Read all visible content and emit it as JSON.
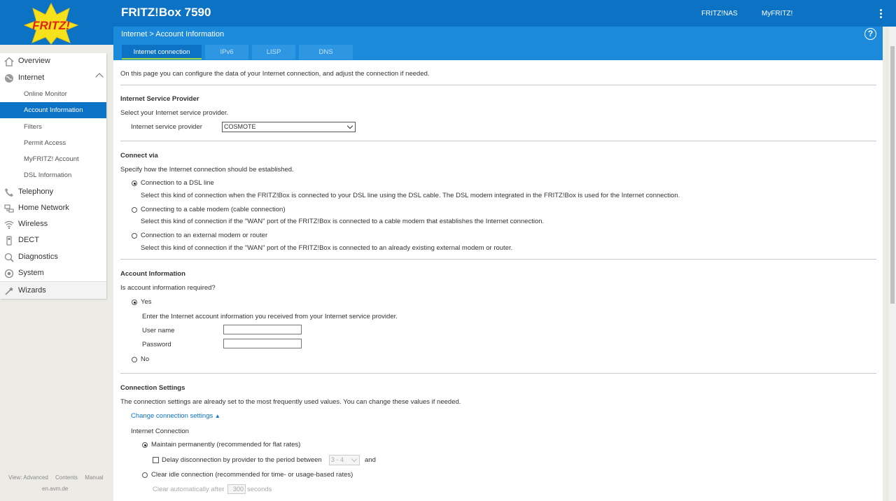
{
  "header": {
    "product": "FRITZ!Box 7590",
    "links": [
      "FRITZ!NAS",
      "MyFRITZ!"
    ],
    "brand_color": "#0c72c4"
  },
  "logo": {
    "text": "FRITZ!"
  },
  "subheader": {
    "breadcrumb": [
      "Internet",
      "Account Information"
    ],
    "separator": ">",
    "help": "?",
    "tabs": [
      {
        "label": "Internet connection",
        "active": true
      },
      {
        "label": "IPv6",
        "active": false
      },
      {
        "label": "LISP",
        "active": false
      },
      {
        "label": "DNS Server",
        "active": false
      }
    ]
  },
  "sidebar": {
    "items": [
      {
        "label": "Overview",
        "icon": "home-icon"
      },
      {
        "label": "Internet",
        "icon": "globe-icon",
        "expanded": true
      },
      {
        "label": "Telephony",
        "icon": "phone-icon"
      },
      {
        "label": "Home Network",
        "icon": "network-icon"
      },
      {
        "label": "Wireless",
        "icon": "wifi-icon"
      },
      {
        "label": "DECT",
        "icon": "dect-phone-icon"
      },
      {
        "label": "Diagnostics",
        "icon": "diagnostics-icon"
      },
      {
        "label": "System",
        "icon": "system-gear-icon"
      },
      {
        "label": "Wizards",
        "icon": "wand-icon"
      }
    ],
    "internet_sub": [
      {
        "label": "Online Monitor",
        "active": false
      },
      {
        "label": "Account Information",
        "active": true
      },
      {
        "label": "Filters",
        "active": false
      },
      {
        "label": "Permit Access",
        "active": false
      },
      {
        "label": "MyFRITZ! Account",
        "active": false
      },
      {
        "label": "DSL Information",
        "active": false
      }
    ],
    "footer": {
      "view": "View: Advanced",
      "contents": "Contents",
      "manual": "Manual",
      "site": "en.avm.de"
    }
  },
  "page": {
    "intro": "On this page you can configure the data of your Internet connection, and adjust the connection if needed.",
    "isp": {
      "title": "Internet Service Provider",
      "desc": "Select your Internet service provider.",
      "label": "Internet service provider",
      "value": "COSMOTE"
    },
    "connect": {
      "title": "Connect via",
      "desc": "Specify how the Internet connection should be established.",
      "options": [
        {
          "label": "Connection to a DSL line",
          "desc": "Select this kind of connection when the FRITZ!Box is connected to your DSL line using the DSL cable. The DSL modem integrated in the FRITZ!Box is used for the Internet connection.",
          "selected": true
        },
        {
          "label": "Connecting to a cable modem (cable connection)",
          "desc": "Select this kind of connection if the \"WAN\" port of the FRITZ!Box is connected to a cable modem that establishes the Internet connection.",
          "selected": false
        },
        {
          "label": "Connection to an external modem or router",
          "desc": "Select this kind of connection if the \"WAN\" port of the FRITZ!Box is connected to an already existing external modem or router.",
          "selected": false
        }
      ]
    },
    "account": {
      "title": "Account Information",
      "question": "Is account information required?",
      "yes": "Yes",
      "no": "No",
      "yes_selected": true,
      "hint": "Enter the Internet account information you received from your Internet service provider.",
      "username_label": "User name",
      "username_value": "",
      "password_label": "Password",
      "password_value": ""
    },
    "settings": {
      "title": "Connection Settings",
      "desc": "The connection settings are already set to the most frequently used values. You can change these values if needed.",
      "toggle_link": "Change connection settings",
      "toggle_icon": "triangle-up-icon",
      "internet_connection": "Internet Connection",
      "maintain": "Maintain permanently (recommended for flat rates)",
      "maintain_selected": true,
      "delay_label": "Delay disconnection by provider to the period between",
      "delay_checked": false,
      "delay_value": "3 - 4",
      "delay_and": "and",
      "clear_idle": "Clear idle connection (recommended for time- or usage-based rates)",
      "clear_idle_selected": false,
      "clear_after_label": "Clear automatically after",
      "clear_after_value": "300",
      "clear_after_unit": "seconds"
    }
  }
}
